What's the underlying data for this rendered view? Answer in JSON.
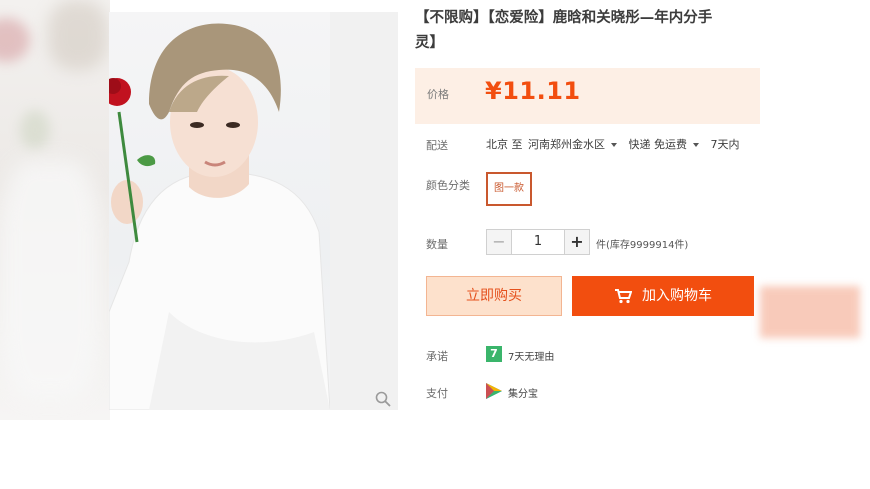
{
  "product": {
    "title": "【不限购】【恋爱险】鹿晗和关晓彤—年内分手\n灵】"
  },
  "price": {
    "label": "价格",
    "value": "¥11.11"
  },
  "shipping": {
    "label": "配送",
    "from": "北京 至",
    "to": "河南郑州金水区",
    "method": "快递 免运费",
    "time": "7天内"
  },
  "color": {
    "label": "颜色分类",
    "option": "图一款"
  },
  "quantity": {
    "label": "数量",
    "minus": "−",
    "value": "1",
    "plus": "+",
    "stock": "件(库存9999914件)"
  },
  "actions": {
    "buy_now": "立即购买",
    "add_to_cart": "加入购物车"
  },
  "promise": {
    "label": "承诺",
    "icon_text": "7",
    "text": "7天无理由"
  },
  "payment": {
    "label": "支付",
    "text": "集分宝"
  },
  "colors": {
    "accent": "#f24e0f",
    "price_bg": "#fdefe5"
  }
}
